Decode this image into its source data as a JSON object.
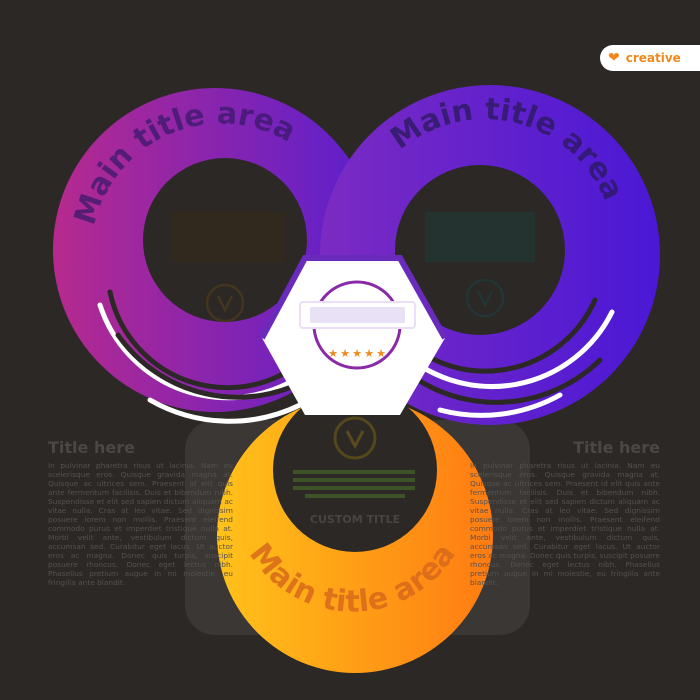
{
  "badge": {
    "label": "creative",
    "icon": "heart-icon"
  },
  "rings": [
    {
      "title": "Main title area",
      "gradient": [
        "#b62a8e",
        "#5a1fcf"
      ]
    },
    {
      "title": "Main title area",
      "gradient": [
        "#7b2bc2",
        "#4a18d6"
      ]
    },
    {
      "title": "Main title area",
      "gradient": [
        "#ffc21a",
        "#ff7b12"
      ]
    }
  ],
  "center_badge": {
    "stars": 5,
    "accent": "#f08a1c",
    "ring_color": "#8a2aa8"
  },
  "bottom_circle": {
    "caption": "CUSTOM TITLE"
  },
  "side_left": {
    "title": "Title here",
    "body": "In pulvinar pharetra risus ut lacinia. Nam eu scelerisque eros. Quisque gravida magna at. Quisque ac ultrices sem. Praesent id elit quis ante fermentum facilisis. Duis et bibendum nibh. Suspendisse et elit sed sapien dictum aliquam ac vitae nulla. Cras at leo vitae. Sed dignissim posuere lorem non mollis. Praesent eleifend commodo purus et imperdiet tristique nulla at. Morbi velit ante, vestibulum dictum quis, accumsan sed. Curabitur eget lacus. Ut auctor eros ac magna. Donec quis turpis, suscipit posuere rhoncus. Donec eget lectus nibh. Phasellus pretium augue in mi molestie, eu fringilla ante blandit."
  },
  "side_right": {
    "title": "Title here",
    "body": "In pulvinar pharetra risus ut lacinia. Nam eu scelerisque eros. Quisque gravida magna at. Quisque ac ultrices sem. Praesent id elit quis ante fermentum facilisis. Duis et bibendum nibh. Suspendisse et elit sed sapien dictum aliquam ac vitae nulla. Cras at leo vitae. Sed dignissim posuere lorem non mollis. Praesent eleifend commodo purus et imperdiet tristique nulla at. Morbi velit ante, vestibulum dictum quis, accumsan sed. Curabitur eget lacus. Ut auctor eros ac magna. Donec quis turpis, suscipit posuere rhoncus. Donec eget lectus nibh. Phasellus pretium augue in mi molestie, eu fringilla ante blandit."
  }
}
